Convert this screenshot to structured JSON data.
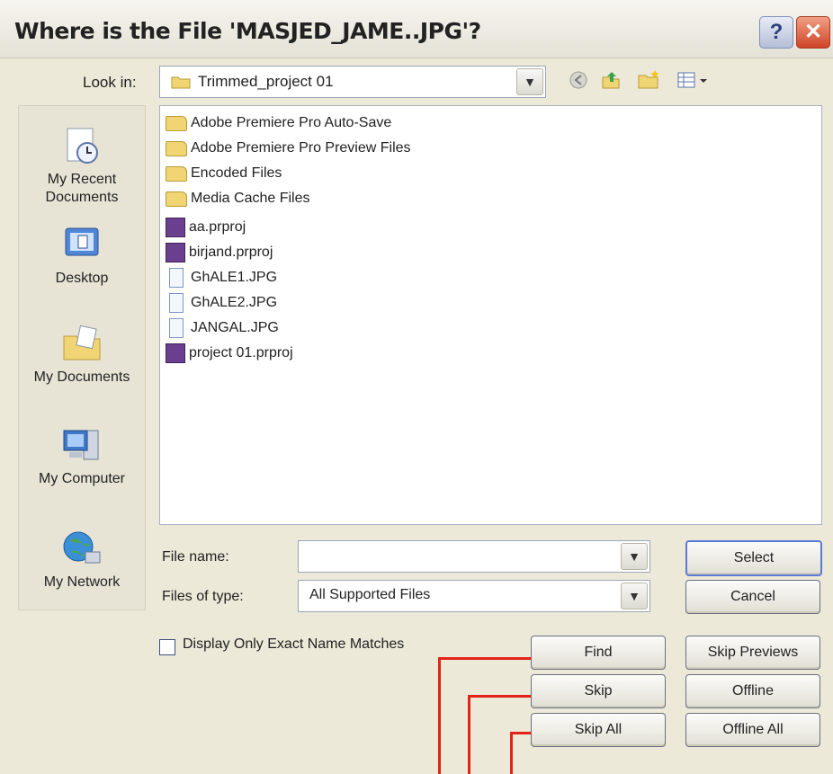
{
  "dialog": {
    "title": "Where is the File 'MASJED_JAME..JPG'?",
    "help_label": "?",
    "close_label": "✕"
  },
  "toolbar": {
    "look_in_label": "Look in:",
    "look_in_value": "Trimmed_project 01",
    "icons": [
      "back-icon",
      "up-folder-icon",
      "new-folder-icon",
      "view-menu-icon"
    ]
  },
  "places": [
    {
      "label_line1": "My Recent",
      "label_line2": "Documents",
      "icon": "recent-documents-icon"
    },
    {
      "label_line1": "Desktop",
      "label_line2": "",
      "icon": "desktop-icon"
    },
    {
      "label_line1": "My Documents",
      "label_line2": "",
      "icon": "my-documents-icon"
    },
    {
      "label_line1": "My Computer",
      "label_line2": "",
      "icon": "my-computer-icon"
    },
    {
      "label_line1": "My Network",
      "label_line2": "",
      "icon": "my-network-icon"
    }
  ],
  "files": [
    {
      "name": "Adobe Premiere Pro Auto-Save",
      "type": "folder"
    },
    {
      "name": "Adobe Premiere Pro Preview Files",
      "type": "folder"
    },
    {
      "name": "Encoded Files",
      "type": "folder"
    },
    {
      "name": "Media Cache Files",
      "type": "folder"
    },
    {
      "name": "aa.prproj",
      "type": "prproj"
    },
    {
      "name": "birjand.prproj",
      "type": "prproj"
    },
    {
      "name": "GhALE1.JPG",
      "type": "jpg"
    },
    {
      "name": "GhALE2.JPG",
      "type": "jpg"
    },
    {
      "name": "JANGAL.JPG",
      "type": "jpg"
    },
    {
      "name": "project 01.prproj",
      "type": "prproj"
    }
  ],
  "form": {
    "file_name_label": "File name:",
    "file_name_value": "",
    "file_type_label": "Files of type:",
    "file_type_value": "All Supported Files"
  },
  "buttons": {
    "select": "Select",
    "cancel": "Cancel",
    "find": "Find",
    "skip_previews": "Skip Previews",
    "skip": "Skip",
    "offline": "Offline",
    "skip_all": "Skip All",
    "offline_all": "Offline All"
  },
  "options": {
    "exact_match_label": "Display Only Exact Name Matches",
    "exact_match_checked": false
  },
  "colors": {
    "callout": "#e2231a",
    "focus_border": "#5a7bd5"
  }
}
